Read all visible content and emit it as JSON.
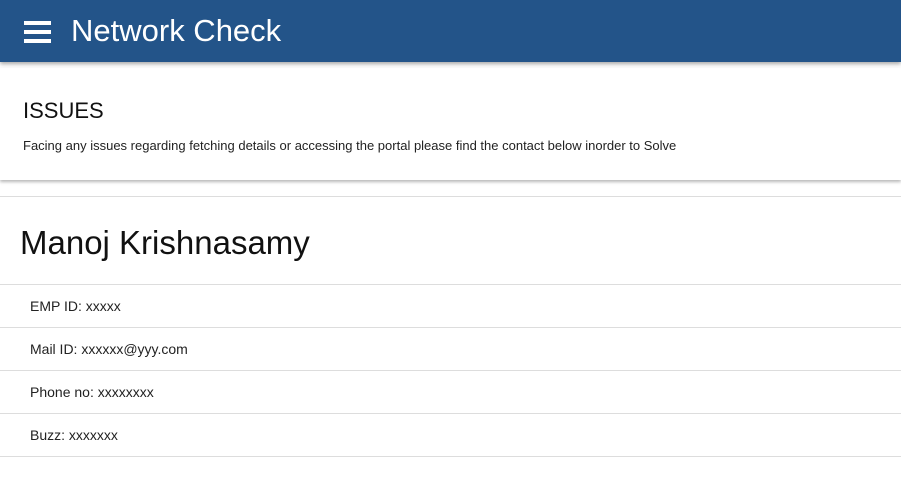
{
  "header": {
    "menu_icon": "hamburger-menu-icon",
    "title": "Network Check",
    "background": "#235489"
  },
  "issues": {
    "title": "ISSUES",
    "description": "Facing any issues regarding fetching details or accessing the portal please find the contact below inorder to Solve"
  },
  "contact": {
    "name": "Manoj Krishnasamy",
    "details": [
      "EMP ID: xxxxx",
      "Mail ID: xxxxxx@yyy.com",
      "Phone no: xxxxxxxx",
      "Buzz: xxxxxxx"
    ]
  }
}
